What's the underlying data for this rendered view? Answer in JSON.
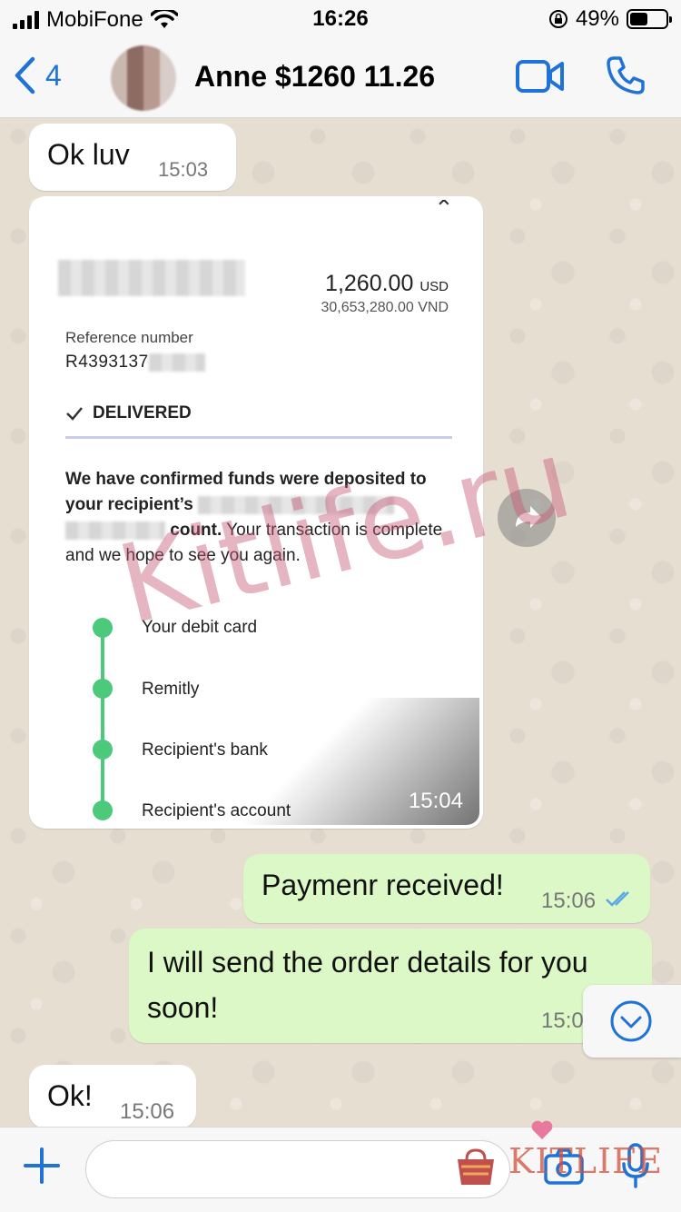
{
  "status_bar": {
    "carrier": "MobiFone",
    "time": "16:26",
    "battery_percent": "49%",
    "battery_level": 0.49
  },
  "header": {
    "back_count": "4",
    "contact_name": "Anne $1260 11.26",
    "icons": [
      "chevron-left-icon",
      "video-call-icon",
      "phone-icon"
    ],
    "accent_color": "#1f73d6"
  },
  "messages": [
    {
      "id": "m1",
      "direction": "incoming",
      "text": "Ok luv",
      "time": "15:03"
    },
    {
      "id": "m2",
      "direction": "incoming",
      "type": "image",
      "time": "15:04",
      "receipt": {
        "amount_value": "1,260.00",
        "amount_currency": "USD",
        "amount_converted": "30,653,280.00 VND",
        "reference_label": "Reference number",
        "reference_value": "R4393137",
        "status": "DELIVERED",
        "confirm_bold_1": "We have confirmed funds were deposited to your recipient’s",
        "confirm_bold_2": "count.",
        "confirm_rest": " Your transaction is complete and we hope to see you again.",
        "timeline": [
          "Your debit card",
          "Remitly",
          "Recipient's bank",
          "Recipient's account"
        ]
      }
    },
    {
      "id": "m3",
      "direction": "outgoing",
      "text": "Paymenr received!",
      "time": "15:06",
      "status": "read"
    },
    {
      "id": "m4",
      "direction": "outgoing",
      "text": "I will send the order details for you soon!",
      "time": "15:0"
    },
    {
      "id": "m5",
      "direction": "incoming",
      "text": "Ok!",
      "time": "15:06"
    }
  ],
  "watermark": "Kitlife.ru",
  "brand_logo": "KITLIFE",
  "input": {
    "placeholder": ""
  },
  "colors": {
    "incoming_bubble": "#ffffff",
    "outgoing_bubble": "#dbf8c6",
    "timeline_green": "#4cc97a",
    "read_ticks": "#5aa9e6"
  }
}
